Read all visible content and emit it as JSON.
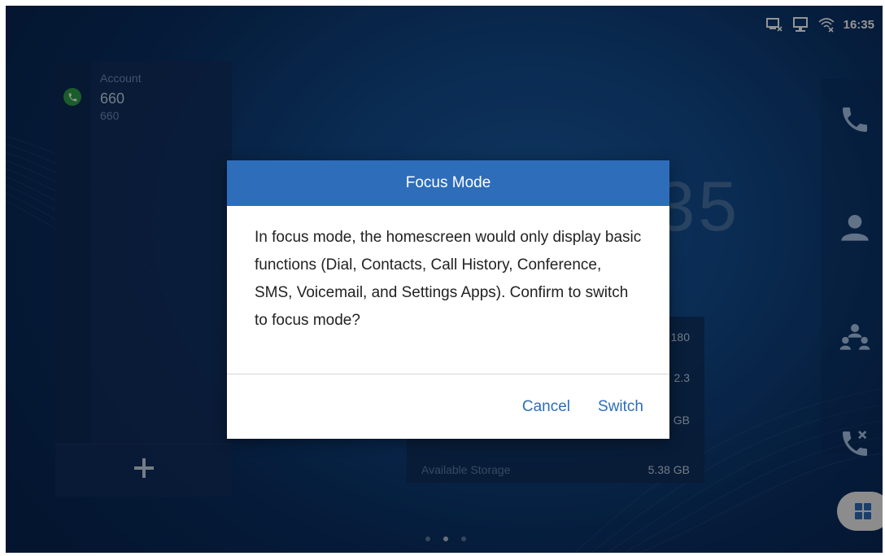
{
  "status_bar": {
    "time": "16:35",
    "icons": [
      "network-off-icon",
      "ethernet-off-icon",
      "wifi-off-icon"
    ]
  },
  "account_widget": {
    "label": "Account",
    "number": "660",
    "sub_number": "660",
    "icon": "phone-icon",
    "add_icon": "plus-icon"
  },
  "clock": {
    "text": "16:35"
  },
  "info_card": {
    "rows": [
      {
        "key": "",
        "value": "180"
      },
      {
        "key": "",
        "value": "2.3"
      },
      {
        "key": "",
        "value": "GB"
      },
      {
        "key": "Available Storage",
        "value": "5.38 GB"
      }
    ]
  },
  "dock": {
    "items": [
      "phone-icon",
      "contact-icon",
      "conference-icon",
      "call-history-icon"
    ],
    "apps_icon": "apps-grid-icon"
  },
  "pagination": {
    "pages": 3,
    "active_index": 1
  },
  "dialog": {
    "title": "Focus Mode",
    "message": "In focus mode, the homescreen would only display basic functions (Dial, Contacts, Call History, Conference, SMS, Voicemail, and Settings Apps). Confirm to switch to focus mode?",
    "cancel_label": "Cancel",
    "confirm_label": "Switch"
  },
  "colors": {
    "accent": "#2e6dba",
    "account_status": "#2ea04a"
  }
}
